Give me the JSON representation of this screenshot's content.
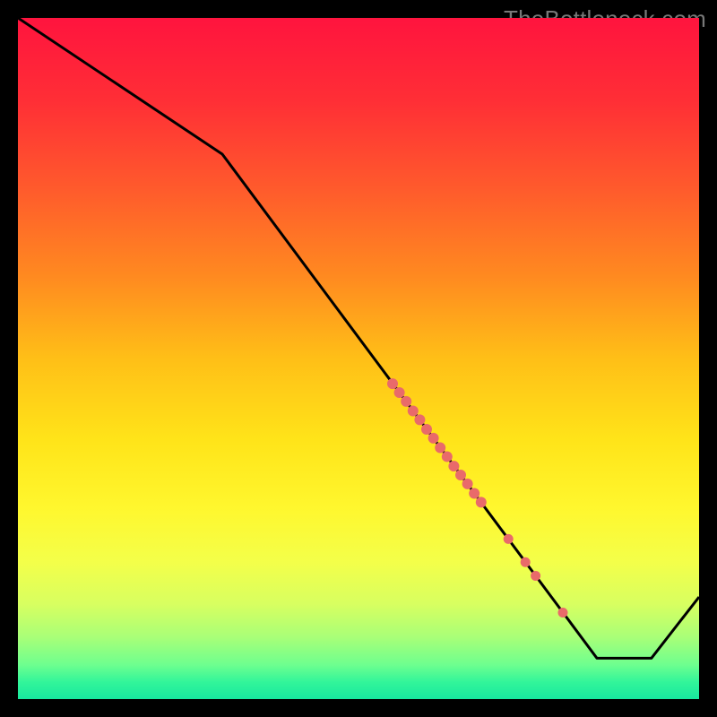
{
  "watermark": "TheBottleneck.com",
  "colors": {
    "line": "#000000",
    "marker": "#e96a6a",
    "gradient_stops": [
      {
        "offset": 0.0,
        "color": "#ff143e"
      },
      {
        "offset": 0.12,
        "color": "#ff2e36"
      },
      {
        "offset": 0.25,
        "color": "#ff5a2c"
      },
      {
        "offset": 0.38,
        "color": "#ff8a20"
      },
      {
        "offset": 0.5,
        "color": "#ffbf17"
      },
      {
        "offset": 0.62,
        "color": "#ffe419"
      },
      {
        "offset": 0.72,
        "color": "#fff72e"
      },
      {
        "offset": 0.8,
        "color": "#f3ff4a"
      },
      {
        "offset": 0.86,
        "color": "#d8ff60"
      },
      {
        "offset": 0.91,
        "color": "#a8ff78"
      },
      {
        "offset": 0.95,
        "color": "#6dff8f"
      },
      {
        "offset": 0.975,
        "color": "#32f59a"
      },
      {
        "offset": 1.0,
        "color": "#18e89e"
      }
    ]
  },
  "chart_data": {
    "type": "line",
    "title": "",
    "xlabel": "",
    "ylabel": "",
    "xlim": [
      0,
      100
    ],
    "ylim": [
      0,
      100
    ],
    "grid": false,
    "legend": false,
    "series": [
      {
        "name": "curve",
        "x": [
          0,
          30,
          85,
          93,
          100
        ],
        "y": [
          100,
          80,
          6,
          6,
          15
        ]
      }
    ],
    "markers": {
      "name": "highlight-points",
      "x": [
        55,
        56,
        57,
        58,
        59,
        60,
        61,
        62,
        63,
        64,
        65,
        66,
        67,
        68,
        72,
        74.5,
        76,
        80
      ],
      "y": [
        46.3,
        45.0,
        43.7,
        42.3,
        41.0,
        39.6,
        38.3,
        36.9,
        35.6,
        34.2,
        32.9,
        31.6,
        30.2,
        28.9,
        23.5,
        20.1,
        18.1,
        12.7
      ],
      "r": [
        6,
        6,
        6,
        6,
        6,
        6,
        6,
        6,
        6,
        6,
        6,
        6,
        6,
        6,
        5.5,
        5.5,
        5.5,
        5.5
      ]
    }
  }
}
